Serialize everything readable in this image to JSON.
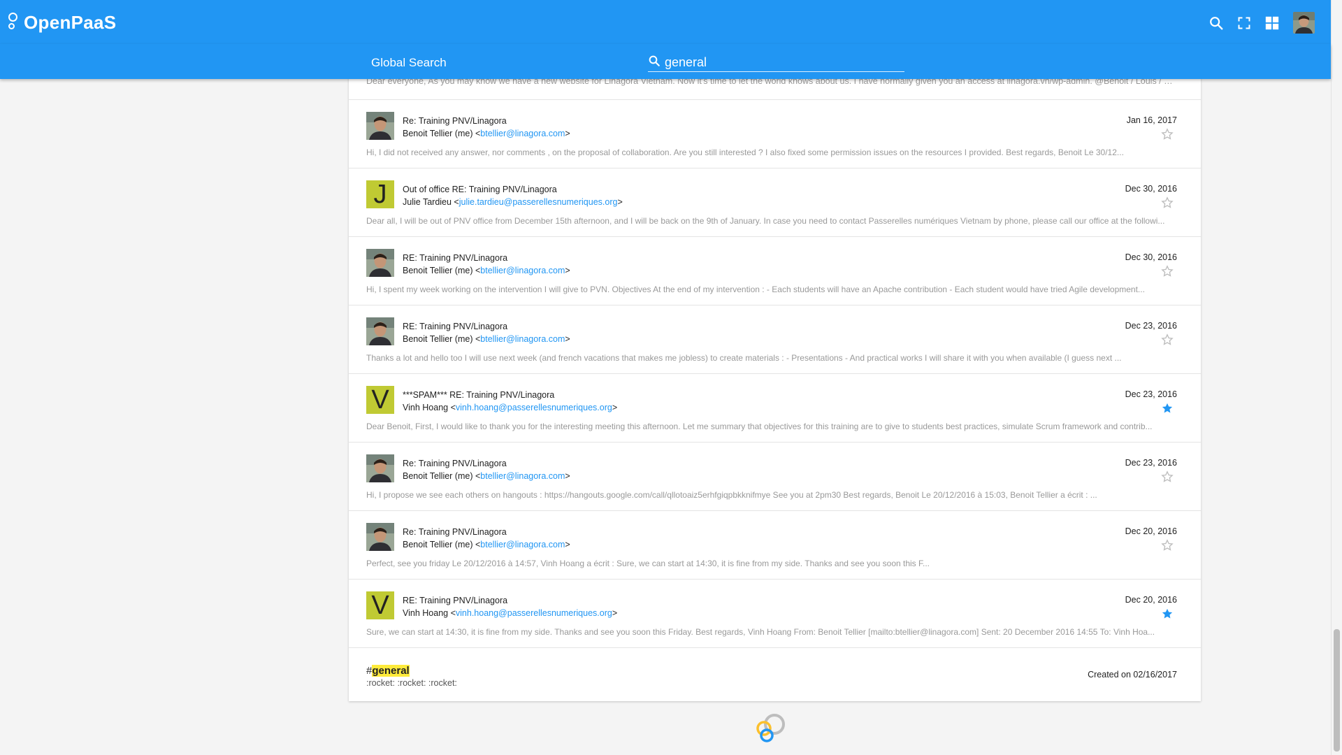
{
  "app": {
    "name": "OpenPaaS"
  },
  "header": {
    "icons": [
      "search-icon",
      "fullscreen-icon",
      "apps-grid-icon",
      "user-avatar"
    ],
    "accent": "#2196f3"
  },
  "subheader": {
    "title": "Global Search",
    "search_value": "general"
  },
  "results": {
    "partial_preview": "Dear everyone, As you may know we have a new website for Linagora Vietnam. Now it's time to let the world knows about us. I have normally given you an access at linagora.vn/wp-admin. @Benoit / Louis / Quynh ...",
    "emails": [
      {
        "avatar": "photo",
        "subject": "Re: Training PNV/Linagora",
        "from_name": "Benoit Tellier (me)",
        "from_email": "btellier@linagora.com",
        "date": "Jan 16, 2017",
        "starred": false,
        "preview": "Hi, I did not received any answer, nor comments , on the proposal of collaboration. Are you still interested ? I also fixed some permission issues on the resources I provided. Best regards, Benoit Le 30/12..."
      },
      {
        "avatar": "J",
        "subject": "Out of office RE: Training PNV/Linagora",
        "from_name": "Julie Tardieu",
        "from_email": "julie.tardieu@passerellesnumeriques.org",
        "date": "Dec 30, 2016",
        "starred": false,
        "preview": "Dear all,  I will be out of PNV office from December 15th afternoon, and I will be back on the 9th of January. In case you need to contact Passerelles numériques Vietnam by phone, please call our office at the followi..."
      },
      {
        "avatar": "photo",
        "subject": "RE: Training PNV/Linagora",
        "from_name": "Benoit Tellier (me)",
        "from_email": "btellier@linagora.com",
        "date": "Dec 30, 2016",
        "starred": false,
        "preview": "Hi, I spent my week working on the intervention I will give to PVN. Objectives At the end of my intervention :  - Each students will have an Apache contribution  - Each student would have tried Agile development..."
      },
      {
        "avatar": "photo",
        "subject": "RE: Training PNV/Linagora",
        "from_name": "Benoit Tellier (me)",
        "from_email": "btellier@linagora.com",
        "date": "Dec 23, 2016",
        "starred": false,
        "preview": "Thanks a lot and hello too I will use next week (and french vacations that makes me jobless) to create materials :  - Presentations  - And practical works I will share it with you when available (I guess next ..."
      },
      {
        "avatar": "V",
        "subject": "***SPAM*** RE: Training PNV/Linagora",
        "from_name": "Vinh Hoang",
        "from_email": "vinh.hoang@passerellesnumeriques.org",
        "date": "Dec 23, 2016",
        "starred": true,
        "preview": "Dear Benoit,   First, I would like to thank you for the interesting meeting this afternoon.   Let me summary that objectives for this training are to give to students best practices, simulate Scrum framework and contrib..."
      },
      {
        "avatar": "photo",
        "subject": "Re: Training PNV/Linagora",
        "from_name": "Benoit Tellier (me)",
        "from_email": "btellier@linagora.com",
        "date": "Dec 23, 2016",
        "starred": false,
        "preview": "Hi, I propose we see each others on hangouts : https://hangouts.google.com/call/qllotoaiz5erhfgiqpbkknifmye See you at 2pm30 Best regards, Benoit Le 20/12/2016 à 15:03, Benoit Tellier a écrit : ..."
      },
      {
        "avatar": "photo",
        "subject": "Re: Training PNV/Linagora",
        "from_name": "Benoit Tellier (me)",
        "from_email": "btellier@linagora.com",
        "date": "Dec 20, 2016",
        "starred": false,
        "preview": "Perfect, see you friday Le 20/12/2016 à 14:57, Vinh Hoang a écrit : Sure, we can start at 14:30, it is fine from my side.   Thanks and see you soon this F..."
      },
      {
        "avatar": "V",
        "subject": "RE: Training PNV/Linagora",
        "from_name": "Vinh Hoang",
        "from_email": "vinh.hoang@passerellesnumeriques.org",
        "date": "Dec 20, 2016",
        "starred": true,
        "preview": "Sure, we can start at 14:30, it is fine from my side.   Thanks and see you soon this Friday.   Best regards,   Vinh Hoang   From: Benoit Tellier [mailto:btellier@linagora.com] Sent: 20 December 2016 14:55 To: Vinh Hoa..."
      }
    ],
    "chat": {
      "hash": "#",
      "channel": "general",
      "message": ":rocket: :rocket: :rocket:",
      "created": "Created on 02/16/2017"
    }
  },
  "colors": {
    "star_active": "#2196f3",
    "star_inactive": "#bdbdbd",
    "avatar_letter_bg": "#c0ca33",
    "highlight": "#ffeb3b"
  }
}
